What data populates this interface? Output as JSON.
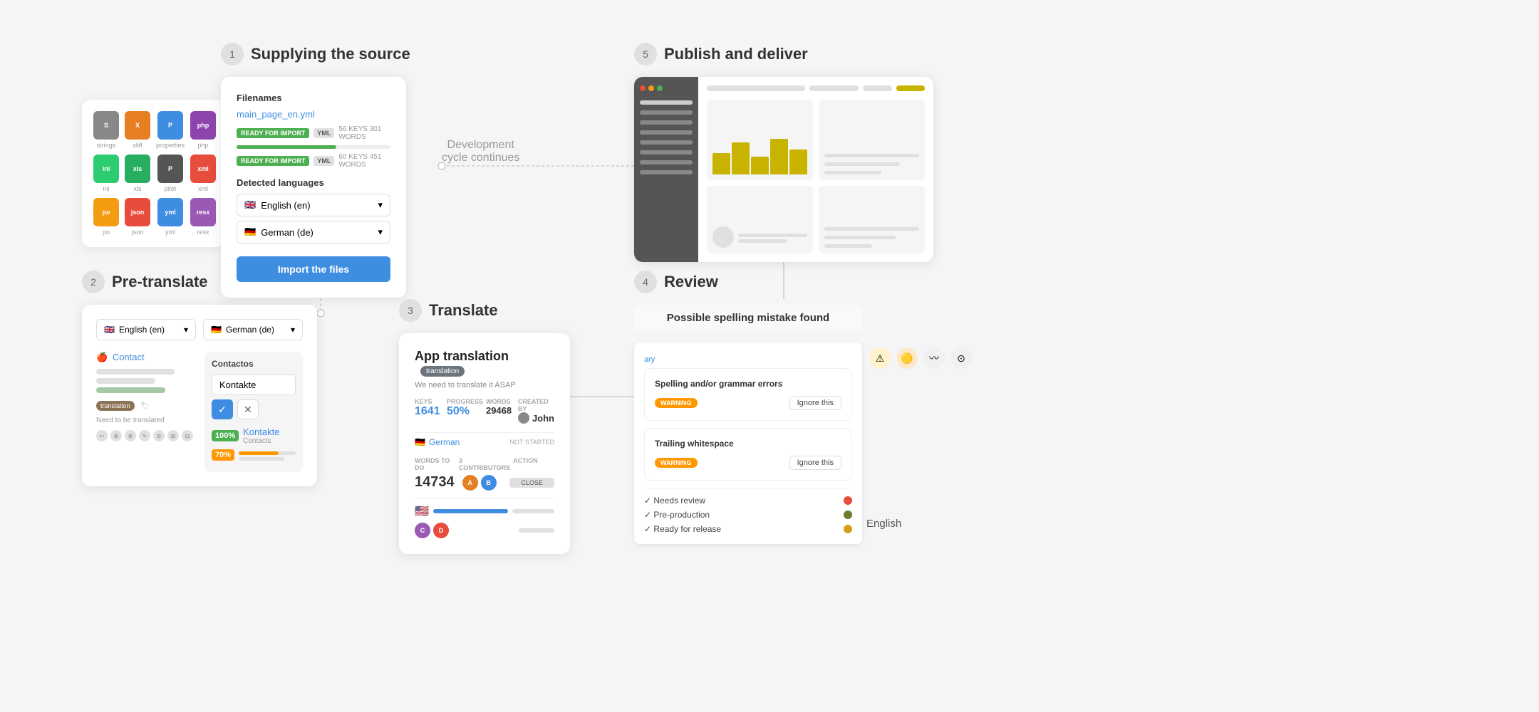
{
  "steps": {
    "step1": {
      "number": "1",
      "title": "Supplying the source",
      "filenames_label": "Filenames",
      "file1_name": "main_page_en.yml",
      "file1_badge": "READY FOR IMPORT",
      "file1_type": "YML",
      "file1_meta": "56 KEYS 301 WORDS",
      "file2_badge": "READY FOR IMPORT",
      "file2_type": "YML",
      "file2_meta": "60 KEYS 451 WORDS",
      "detected_label": "Detected languages",
      "lang1": "English (en)",
      "lang2": "German (de)",
      "import_btn": "Import the files"
    },
    "step2": {
      "number": "2",
      "title": "Pre-translate",
      "lang1": "English (en)",
      "lang2": "German (de)",
      "contact_link": "Contact",
      "contact_translation": "Contactos",
      "kontakte_input": "Kontakte",
      "badge_translation": "translation",
      "need_translate": "Need to be translated",
      "match100_pct": "100%",
      "match100_name": "Kontakte",
      "match100_sub": "Contacts",
      "match70_pct": "70%"
    },
    "step3": {
      "number": "3",
      "title": "Translate",
      "app_title": "App translation",
      "tag": "translation",
      "subtitle": "We need to translate it ASAP",
      "keys_label": "KEYS",
      "keys_value": "1641",
      "progress_label": "PROGRESS",
      "progress_value": "50%",
      "words_label": "WORDS",
      "words_value": "29468",
      "created_label": "CREATED BY",
      "created_value": "John",
      "lang_de": "German",
      "not_started": "NOT STARTED",
      "words_to_do_label": "WORDS TO DO",
      "words_to_do_value": "14734",
      "contributors_label": "3 CONTRIBUTORS",
      "action_label": "ACTION",
      "close_btn": "CLOSE"
    },
    "step4": {
      "number": "4",
      "title": "Review",
      "card_title": "Possible spelling mistake found",
      "error1_title": "Spelling and/or grammar errors",
      "error1_badge": "WARNING",
      "error1_ignore": "Ignore this",
      "error2_title": "Trailing whitespace",
      "error2_badge": "WARNING",
      "error2_ignore": "Ignore this",
      "status1": "Needs review",
      "status2": "Pre-production",
      "status3": "Ready for release",
      "right_text": "ary"
    },
    "step5": {
      "number": "5",
      "title": "Publish and deliver"
    }
  },
  "dev_cycle": "Development\ncycle continues",
  "english_label": "English",
  "file_icons": [
    {
      "label": "strings",
      "color": "#555",
      "text": "S"
    },
    {
      "label": "xliff",
      "color": "#e67e22",
      "text": "X"
    },
    {
      "label": "properties",
      "color": "#3e8de0",
      "text": "P"
    },
    {
      "label": "php",
      "color": "#8e44ad",
      "text": "P"
    },
    {
      "label": "ini",
      "color": "#2ecc71",
      "text": "I"
    },
    {
      "label": "xls",
      "color": "#27ae60",
      "text": "X"
    },
    {
      "label": "pilot",
      "color": "#555",
      "text": "P"
    },
    {
      "label": "xml",
      "color": "#e74c3c",
      "text": "X"
    },
    {
      "label": "po",
      "color": "#f39c12",
      "text": "P"
    },
    {
      "label": "json",
      "color": "#e74c3c",
      "text": "J"
    },
    {
      "label": "yml",
      "color": "#3e8de0",
      "text": "Y"
    },
    {
      "label": "resx",
      "color": "#9b59b6",
      "text": "R"
    }
  ],
  "colors": {
    "accent_blue": "#3e8de0",
    "accent_green": "#4CAF50",
    "accent_orange": "#FF9800",
    "accent_olive": "#8b7355",
    "warning": "#FF9800",
    "status_red": "#e74c3c",
    "status_yellow": "#f39c12",
    "status_olive": "#6b7c2d",
    "status_amber": "#d4a017"
  }
}
